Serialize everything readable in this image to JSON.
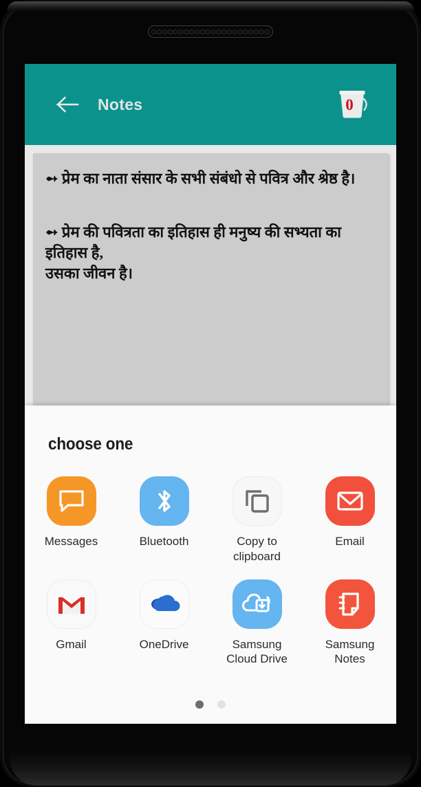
{
  "device": {
    "speaker_grille_holes": 22
  },
  "app_bar": {
    "back_icon": "arrow-left-icon",
    "title": "Notes",
    "trash_icon": "trash-bucket-icon",
    "trash_count": "0",
    "background_color": "#0c928d",
    "title_color": "#dfe5e4",
    "count_color": "#cc0f1f"
  },
  "note": {
    "background_color": "#cccccc",
    "paragraph_1": "➻ प्रेम का नाता संसार के सभी संबंधो से पवित्र और श्रेष्ठ है।",
    "paragraph_2_line_1": "➻ प्रेम की पवित्रता का इतिहास ही मनुष्य की सभ्यता का",
    "paragraph_2_line_2": "इतिहास है,",
    "paragraph_2_line_3": "उसका जीवन है।"
  },
  "share_sheet": {
    "title": "choose one",
    "background_color": "#fafafa",
    "items": [
      {
        "label": "Messages",
        "icon": "messages-icon",
        "icon_bg": "#f59726",
        "icon_fg": "#ffffff"
      },
      {
        "label": "Bluetooth",
        "icon": "bluetooth-icon",
        "icon_bg": "#64b5f0",
        "icon_fg": "#ffffff"
      },
      {
        "label": "Copy to clipboard",
        "icon": "copy-to-clipboard-icon",
        "icon_bg": "#f7f7f7",
        "icon_fg": "#6e6e6e"
      },
      {
        "label": "Email",
        "icon": "email-envelope-icon",
        "icon_bg": "#f2503c",
        "icon_fg": "#ffffff"
      },
      {
        "label": "Gmail",
        "icon": "gmail-icon",
        "icon_bg": "#f9f9f9",
        "icon_fg": "#d93025"
      },
      {
        "label": "OneDrive",
        "icon": "onedrive-cloud-icon",
        "icon_bg": "#fbfbfb",
        "icon_fg": "#1f5fbf"
      },
      {
        "label": "Samsung Cloud Drive",
        "icon": "samsung-cloud-drive-icon",
        "icon_bg": "#64b5f0",
        "icon_fg": "#ffffff"
      },
      {
        "label": "Samsung Notes",
        "icon": "samsung-notes-icon",
        "icon_bg": "#f2553c",
        "icon_fg": "#ffffff"
      }
    ],
    "pagination": {
      "total": 2,
      "active_index": 0
    }
  }
}
